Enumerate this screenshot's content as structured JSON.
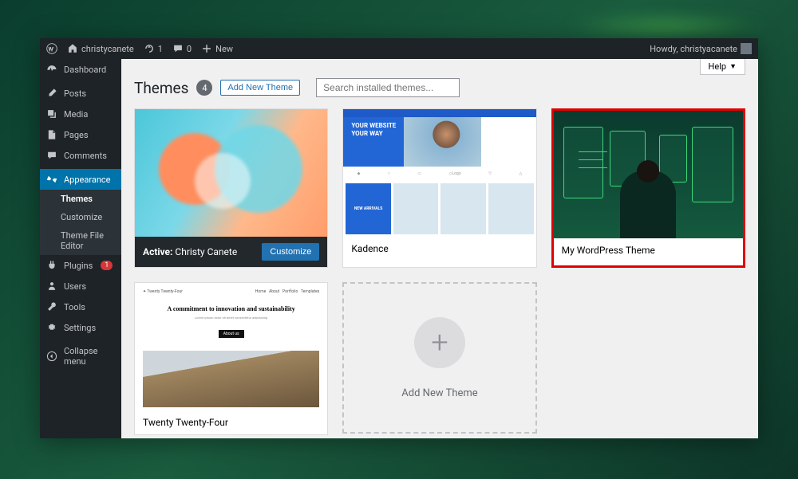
{
  "adminbar": {
    "site": "christycanete",
    "updates": "1",
    "comments": "0",
    "new": "New",
    "greeting": "Howdy, christyacanete"
  },
  "sidebar": {
    "dashboard": "Dashboard",
    "posts": "Posts",
    "media": "Media",
    "pages": "Pages",
    "comments": "Comments",
    "appearance": "Appearance",
    "themes": "Themes",
    "customize": "Customize",
    "theme_file_editor": "Theme File Editor",
    "plugins": "Plugins",
    "plugins_badge": "1",
    "users": "Users",
    "tools": "Tools",
    "settings": "Settings",
    "collapse": "Collapse menu"
  },
  "help": "Help",
  "page": {
    "title": "Themes",
    "count": "4",
    "add_new": "Add New Theme",
    "search_placeholder": "Search installed themes..."
  },
  "themes": {
    "active_prefix": "Active:",
    "active_name": "Christy Canete",
    "customize": "Customize",
    "kadence": "Kadence",
    "mytheme": "My WordPress Theme",
    "twentyfour": "Twenty Twenty-Four",
    "add_new": "Add New Theme"
  },
  "kadence_preview": {
    "hero1": "YOUR WEBSITE",
    "hero2": "YOUR WAY",
    "badge": "NEW ARRIVALS"
  },
  "twentyfour_preview": {
    "heading": "A commitment to innovation and sustainability"
  }
}
